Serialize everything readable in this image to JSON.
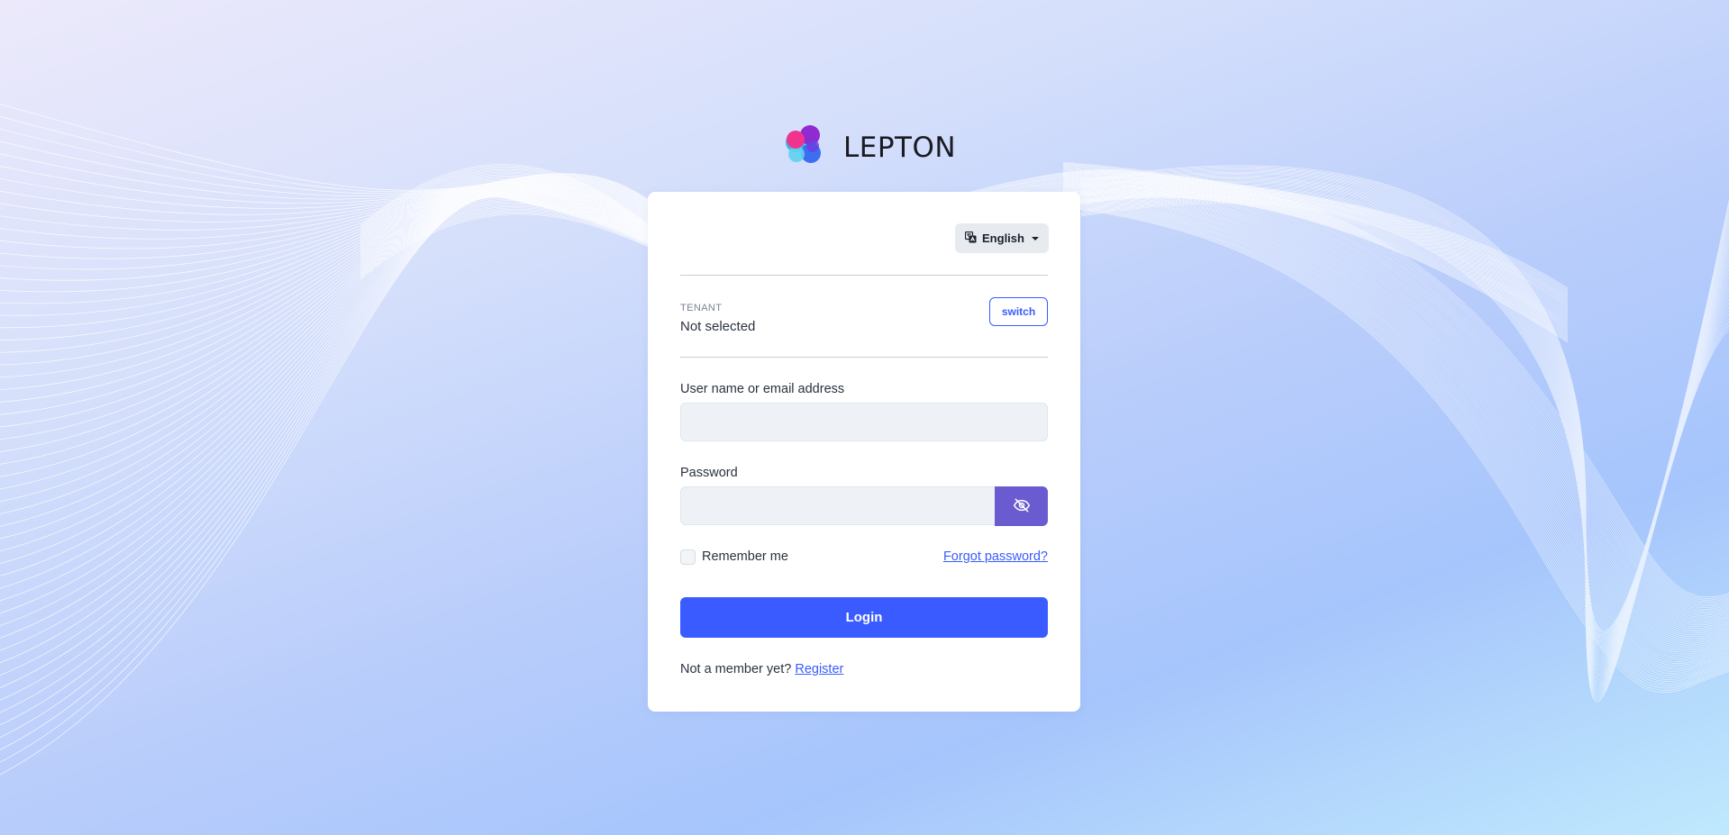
{
  "brand": {
    "name": "LEPTON",
    "logo_icon": "lepton-logo-icon",
    "colors": [
      "#f0348e",
      "#8f2bd0",
      "#38b8ea",
      "#3c6ff0"
    ]
  },
  "language": {
    "selected": "English",
    "icon": "translate-icon"
  },
  "tenant": {
    "label": "TENANT",
    "value": "Not selected",
    "switch_label": "switch"
  },
  "form": {
    "username_label": "User name or email address",
    "username_value": "",
    "password_label": "Password",
    "password_value": "",
    "password_toggle_icon": "eye-slash-icon",
    "remember_label": "Remember me",
    "remember_checked": false,
    "forgot_label": "Forgot password?",
    "login_label": "Login"
  },
  "register": {
    "prompt": "Not a member yet?",
    "link_label": "Register"
  },
  "theme": {
    "accent": "#3a5bff",
    "toggle_bg": "#6b5bd0"
  }
}
